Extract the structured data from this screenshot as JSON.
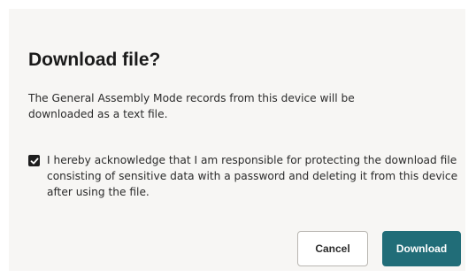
{
  "dialog": {
    "title": "Download file?",
    "message": "The General Assembly Mode  records from this device will be downloaded as a text file.",
    "acknowledgement": {
      "checked": true,
      "label": "I hereby acknowledge that I am responsible for protecting the download file consisting of sensitive data with a password and deleting it from this device after using the file."
    },
    "buttons": {
      "cancel_label": "Cancel",
      "download_label": "Download"
    }
  },
  "colors": {
    "dialog_background": "#f7f6f4",
    "primary_button": "#216d78",
    "checkbox_fill": "#1e1e1e"
  },
  "icons": {
    "checkbox": "checkmark-icon"
  }
}
